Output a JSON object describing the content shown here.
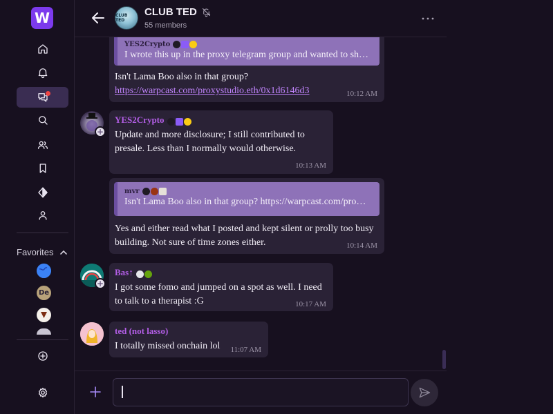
{
  "app": {
    "logo_letter": "W",
    "accent": "#7c3aed"
  },
  "rail": {
    "nav_items": [
      {
        "name": "home",
        "icon": "home-icon"
      },
      {
        "name": "notifications",
        "icon": "bell-icon"
      },
      {
        "name": "direct-casts",
        "icon": "chat-icon",
        "active": true,
        "badge": true
      },
      {
        "name": "search",
        "icon": "search-icon"
      },
      {
        "name": "channels",
        "icon": "users-icon"
      },
      {
        "name": "bookmarks",
        "icon": "bookmark-icon"
      },
      {
        "name": "explore",
        "icon": "diamond-icon"
      },
      {
        "name": "profile",
        "icon": "user-icon"
      }
    ],
    "favorites_label": "Favorites",
    "favorites": [
      {
        "label": "",
        "color": "#3b82f6"
      },
      {
        "label": "De",
        "color": "#b8a27a"
      },
      {
        "label": "",
        "color": "#f5f0ea"
      },
      {
        "label": "",
        "color": "#c9c4d2"
      }
    ]
  },
  "header": {
    "group_name": "CLUB TED",
    "avatar_text": "CLUB TED",
    "member_count": "55 members"
  },
  "messages": [
    {
      "id": "m1",
      "quote": {
        "author": "YES2Crypto",
        "text": "I wrote this up in the proxy telegram group and wanted to sh…"
      },
      "text": "Isn't Lama Boo also in that group?",
      "link": "https://warpcast.com/proxystudio.eth/0x1d6146d3",
      "time": "10:12 AM"
    },
    {
      "id": "m2",
      "author": "YES2Crypto",
      "text": "Update and more disclosure; I still contributed to presale. Less than I normally would otherwise.",
      "time": "10:13 AM"
    },
    {
      "id": "m3",
      "quote": {
        "author": "mvr",
        "text": "Isn't Lama Boo also in that group? https://warpcast.com/pro…"
      },
      "text": "Yes and either read what I posted and kept silent or prolly too busy building. Not sure of time zones either.",
      "time": "10:14 AM"
    },
    {
      "id": "m4",
      "author": "Bas↑",
      "text": "I got some fomo and jumped on a spot as well. I need to talk to a therapist :G",
      "time": "10:17 AM"
    },
    {
      "id": "m5",
      "author": "ted (not lasso)",
      "text": "I totally missed onchain lol",
      "time": "11:07 AM"
    }
  ],
  "composer": {
    "value": "",
    "placeholder": ""
  }
}
